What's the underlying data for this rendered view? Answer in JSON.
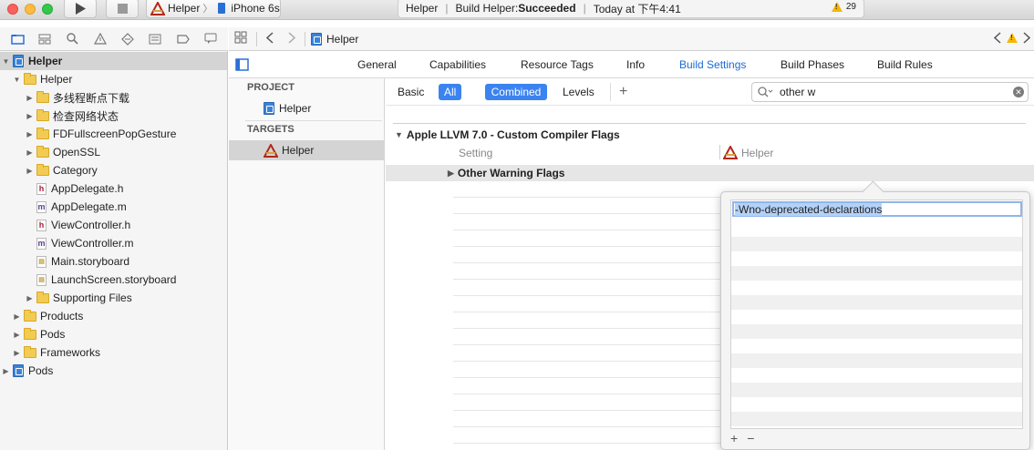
{
  "titlebar": {
    "scheme_target": "Helper",
    "scheme_device": "iPhone 6s",
    "activity_project": "Helper",
    "activity_status_prefix": "Build Helper: ",
    "activity_status": "Succeeded",
    "activity_time": "Today at 下午4:41",
    "warning_count": "29"
  },
  "navigator": {
    "items": [
      {
        "label": "Helper"
      },
      {
        "label": "Helper"
      },
      {
        "label": "多线程断点下载"
      },
      {
        "label": "检查网络状态"
      },
      {
        "label": "FDFullscreenPopGesture"
      },
      {
        "label": "OpenSSL"
      },
      {
        "label": "Category"
      },
      {
        "label": "AppDelegate.h"
      },
      {
        "label": "AppDelegate.m"
      },
      {
        "label": "ViewController.h"
      },
      {
        "label": "ViewController.m"
      },
      {
        "label": "Main.storyboard"
      },
      {
        "label": "LaunchScreen.storyboard"
      },
      {
        "label": "Supporting Files"
      },
      {
        "label": "Products"
      },
      {
        "label": "Pods"
      },
      {
        "label": "Frameworks"
      },
      {
        "label": "Pods"
      }
    ]
  },
  "jumpbar": {
    "crumb": "Helper"
  },
  "tabs": [
    "General",
    "Capabilities",
    "Resource Tags",
    "Info",
    "Build Settings",
    "Build Phases",
    "Build Rules"
  ],
  "targets_panel": {
    "project_header": "PROJECT",
    "project_item": "Helper",
    "targets_header": "TARGETS",
    "target_item": "Helper"
  },
  "filter": {
    "basic": "Basic",
    "all": "All",
    "combined": "Combined",
    "levels": "Levels",
    "search_value": "other w"
  },
  "settings": {
    "section_title": "Apple LLVM 7.0 - Custom Compiler Flags",
    "col_setting": "Setting",
    "col_target": "Helper",
    "row_label": "Other Warning Flags"
  },
  "popover": {
    "value": "-Wno-deprecated-declarations",
    "add": "+",
    "remove": "−"
  },
  "colors": {
    "accent": "#3b83f0",
    "link": "#1a6ad7",
    "warning": "#f5b800"
  }
}
